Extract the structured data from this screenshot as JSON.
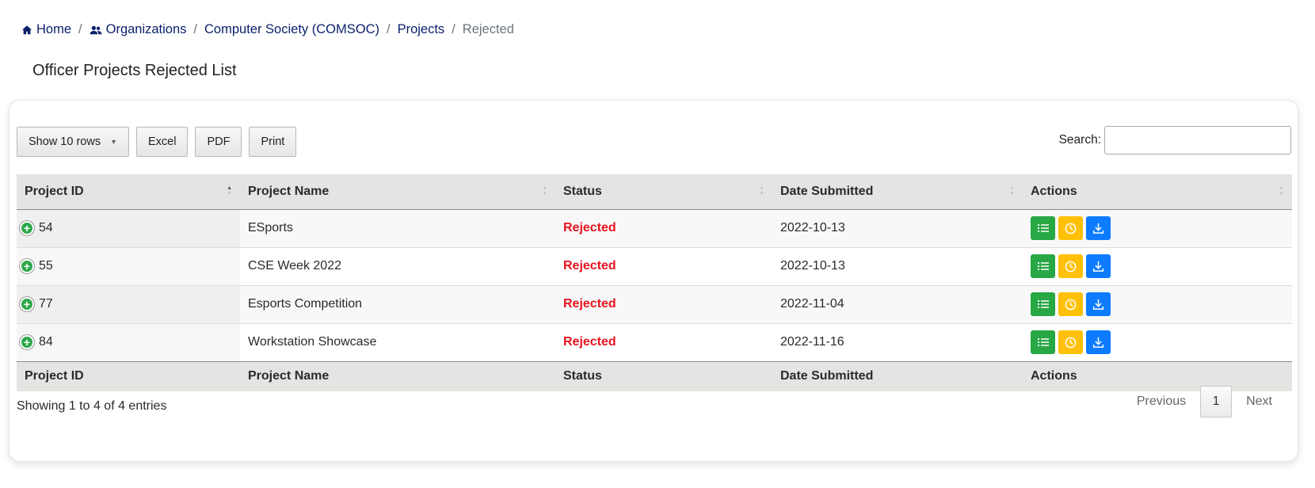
{
  "breadcrumb": {
    "items": [
      {
        "label": "Home",
        "icon": "home-icon"
      },
      {
        "label": "Organizations",
        "icon": "users-icon"
      },
      {
        "label": "Computer Society (COMSOC)"
      },
      {
        "label": "Projects"
      },
      {
        "label": "Rejected",
        "active": true
      }
    ],
    "separator": "/"
  },
  "page": {
    "title": "Officer Projects Rejected List"
  },
  "toolbar": {
    "show_rows": "Show 10 rows",
    "excel": "Excel",
    "pdf": "PDF",
    "print": "Print"
  },
  "search": {
    "label": "Search:",
    "value": ""
  },
  "table": {
    "columns": [
      "Project ID",
      "Project Name",
      "Status",
      "Date Submitted",
      "Actions"
    ],
    "rows": [
      {
        "id": "54",
        "name": "ESports",
        "status": "Rejected",
        "date": "2022-10-13"
      },
      {
        "id": "55",
        "name": "CSE Week 2022",
        "status": "Rejected",
        "date": "2022-10-13"
      },
      {
        "id": "77",
        "name": "Esports Competition",
        "status": "Rejected",
        "date": "2022-11-04"
      },
      {
        "id": "84",
        "name": "Workstation Showcase",
        "status": "Rejected",
        "date": "2022-11-16"
      }
    ],
    "action_icons": [
      "list-icon",
      "clock-icon",
      "download-icon"
    ]
  },
  "footer": {
    "info": "Showing 1 to 4 of 4 entries",
    "previous": "Previous",
    "current_page": "1",
    "next": "Next"
  },
  "colors": {
    "link": "#0a1f6b",
    "rejected": "#e8131f",
    "green": "#28a745",
    "yellow": "#ffc107",
    "blue": "#0d7bff"
  }
}
